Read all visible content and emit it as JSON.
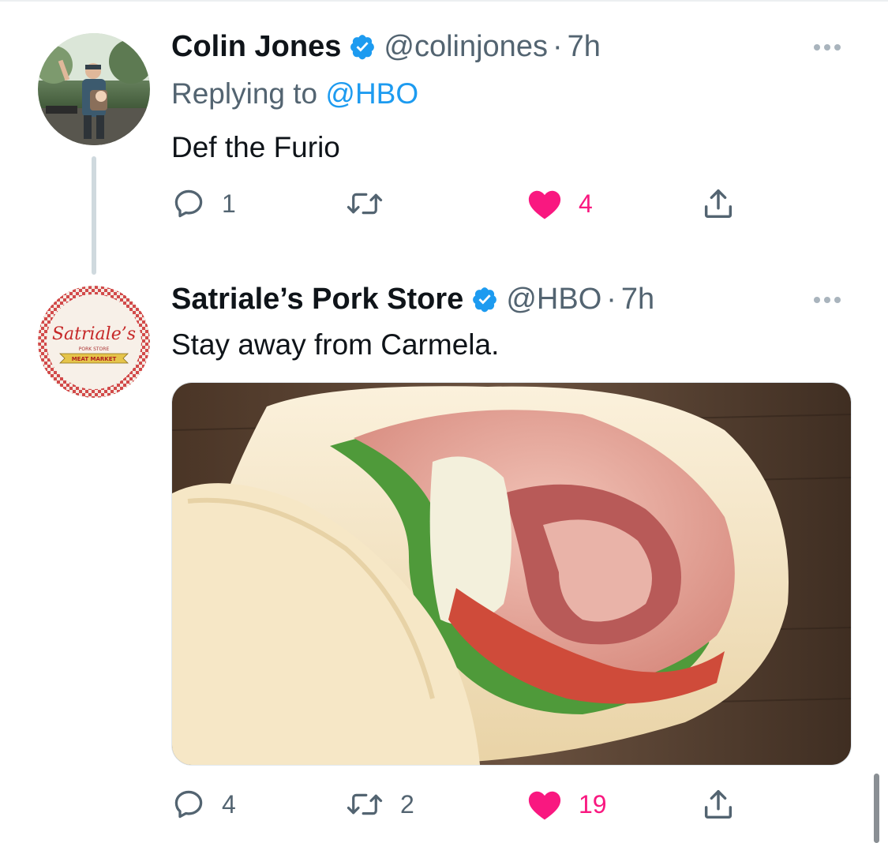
{
  "tweets": [
    {
      "name": "Colin Jones",
      "handle": "@colinjones",
      "separator": "·",
      "time": "7h",
      "replying_prefix": "Replying to ",
      "replying_to": "@HBO",
      "text": "Def the Furio",
      "reply_count": "1",
      "retweet_count": "",
      "like_count": "4",
      "liked": true
    },
    {
      "name": "Satriale’s Pork Store",
      "handle": "@HBO",
      "separator": "·",
      "time": "7h",
      "text": "Stay away from Carmela.",
      "reply_count": "4",
      "retweet_count": "2",
      "like_count": "19",
      "liked": true,
      "avatar_text": {
        "script": "Satriale’s",
        "subtitle": "PORK STORE",
        "banner": "MEAT MARKET"
      }
    }
  ],
  "colors": {
    "accent": "#1d9bf0",
    "like": "#f91880",
    "secondary_text": "#536471"
  },
  "icons": [
    "verified-badge-icon",
    "more-icon",
    "reply-icon",
    "retweet-icon",
    "like-icon",
    "share-icon"
  ]
}
